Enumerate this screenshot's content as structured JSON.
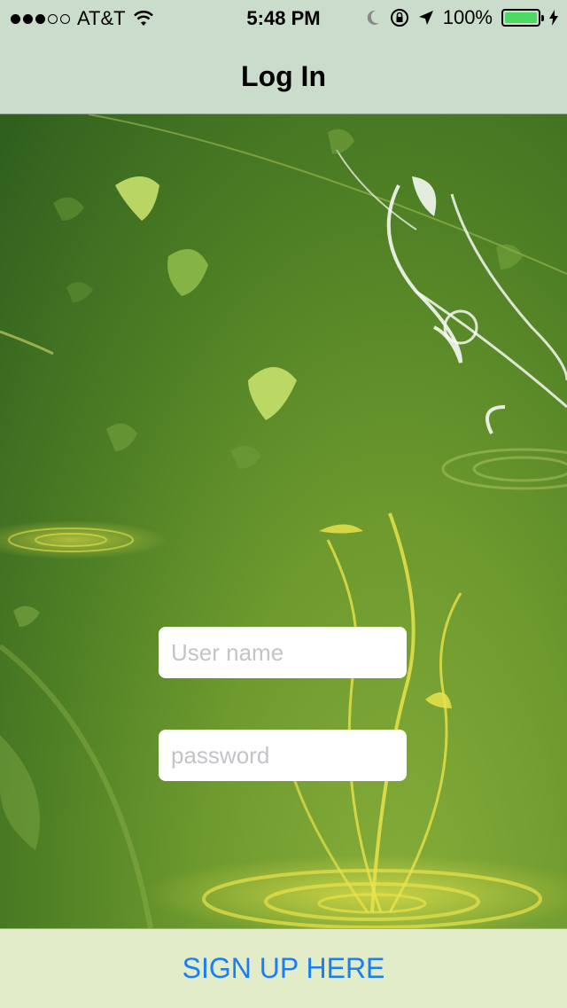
{
  "status_bar": {
    "carrier": "AT&T",
    "signal_bars_filled": 3,
    "signal_bars_total": 5,
    "time": "5:48 PM",
    "battery_percent": "100%",
    "battery_level": 1.0,
    "icons": [
      "wifi-icon",
      "moon-icon",
      "orientation-lock-icon",
      "location-arrow-icon",
      "charging-bolt-icon"
    ]
  },
  "nav": {
    "title": "Log In"
  },
  "form": {
    "username_placeholder": "User name",
    "username_value": "",
    "password_placeholder": "password",
    "password_value": ""
  },
  "footer": {
    "signup_label": "SIGN UP HERE"
  },
  "colors": {
    "nav_background": "#cadccb",
    "bottom_bar_background": "#e3ecc8",
    "link_blue": "#1a7ff0",
    "battery_green": "#4cd964",
    "bg_dark_green": "#2f5e1e",
    "bg_light_green": "#86ad3a",
    "flourish_yellow": "#e8e34a"
  }
}
